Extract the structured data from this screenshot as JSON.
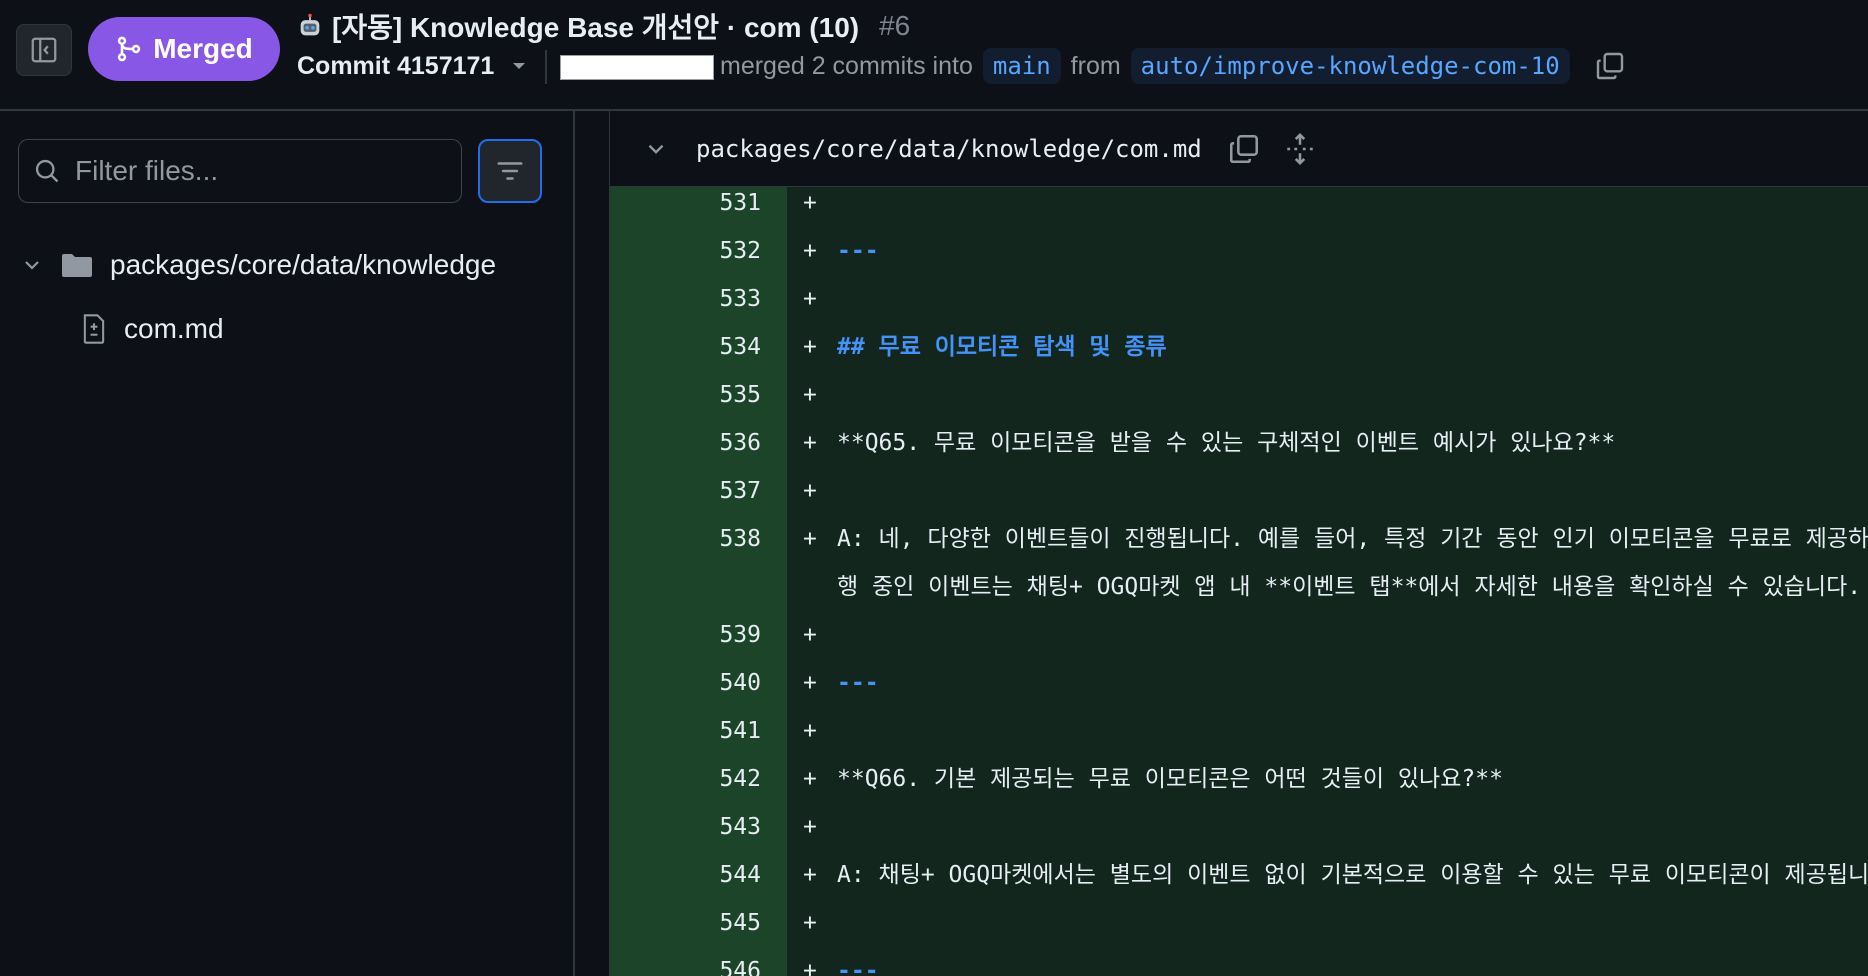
{
  "header": {
    "status": "Merged",
    "title": "[자동] Knowledge Base 개선안 · com (10)",
    "number": "#6",
    "commit_label": "Commit 4157171",
    "merged_text": "merged 2 commits into",
    "base_branch": "main",
    "from_text": "from",
    "head_branch": "auto/improve-knowledge-com-10",
    "colors": {
      "merged": "#8957e5",
      "branch_fg": "#58a6ff",
      "branch_bg": "#121d2f"
    }
  },
  "sidebar": {
    "filter_placeholder": "Filter files...",
    "folder": "packages/core/data/knowledge",
    "file": "com.md"
  },
  "diff": {
    "file_path": "packages/core/data/knowledge/com.md",
    "colors": {
      "gutter_added": "#1c4428",
      "code_added": "#12261e",
      "heading": "#4493f8"
    },
    "rows": [
      {
        "num": "531",
        "marker": "+",
        "text": ""
      },
      {
        "num": "532",
        "marker": "+",
        "text": "---"
      },
      {
        "num": "533",
        "marker": "+",
        "text": ""
      },
      {
        "num": "534",
        "marker": "+",
        "text": "## 무료 이모티콘 탐색 및 종류"
      },
      {
        "num": "535",
        "marker": "+",
        "text": ""
      },
      {
        "num": "536",
        "marker": "+",
        "text": "**Q65. 무료 이모티콘을 받을 수 있는 구체적인 이벤트 예시가 있나요?**"
      },
      {
        "num": "537",
        "marker": "+",
        "text": ""
      },
      {
        "num": "538",
        "marker": "+",
        "text": "A: 네, 다양한 이벤트들이 진행됩니다. 예를 들어, 특정 기간 동안 인기 이모티콘을 무료로 제공하는"
      },
      {
        "num": "",
        "marker": "",
        "text": "행 중인 이벤트는 채팅+ OGQ마켓 앱 내 **이벤트 탭**에서 자세한 내용을 확인하실 수 있습니다."
      },
      {
        "num": "539",
        "marker": "+",
        "text": ""
      },
      {
        "num": "540",
        "marker": "+",
        "text": "---"
      },
      {
        "num": "541",
        "marker": "+",
        "text": ""
      },
      {
        "num": "542",
        "marker": "+",
        "text": "**Q66. 기본 제공되는 무료 이모티콘은 어떤 것들이 있나요?**"
      },
      {
        "num": "543",
        "marker": "+",
        "text": ""
      },
      {
        "num": "544",
        "marker": "+",
        "text": "A: 채팅+ OGQ마켓에서는 별도의 이벤트 없이 기본적으로 이용할 수 있는 무료 이모티콘이 제공됩니다"
      },
      {
        "num": "545",
        "marker": "+",
        "text": ""
      },
      {
        "num": "546",
        "marker": "+",
        "text": "---"
      }
    ]
  }
}
